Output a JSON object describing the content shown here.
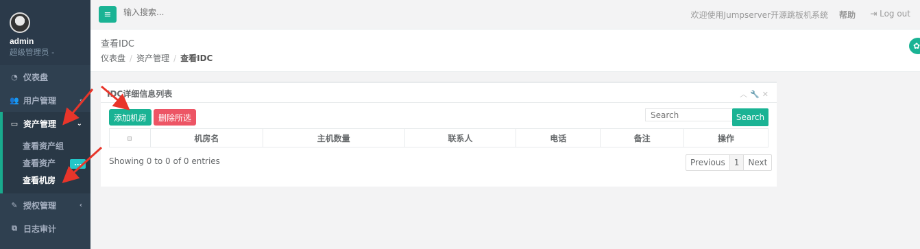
{
  "sidebar": {
    "user_name": "admin",
    "user_role": "超级管理员 -",
    "items": [
      {
        "label": "仪表盘",
        "icon": "dashboard-icon"
      },
      {
        "label": "用户管理",
        "icon": "users-icon"
      },
      {
        "label": "资产管理",
        "icon": "inbox-icon"
      },
      {
        "label": "授权管理",
        "icon": "edit-icon"
      },
      {
        "label": "日志审计",
        "icon": "copy-icon"
      }
    ],
    "subitems": [
      {
        "label": "查看资产组"
      },
      {
        "label": "查看资产",
        "badge": "..."
      },
      {
        "label": "查看机房"
      }
    ]
  },
  "topbar": {
    "search_placeholder": "输入搜索...",
    "welcome": "欢迎使用Jumpserver开源跳板机系统",
    "help": "帮助",
    "logout": "Log out"
  },
  "heading": {
    "title": "查看IDC",
    "breadcrumbs": [
      "仪表盘",
      "资产管理",
      "查看IDC"
    ]
  },
  "panel": {
    "title": "IDC详细信息列表",
    "add_button": "添加机房",
    "delete_button": "删除所选",
    "search_placeholder": "Search",
    "search_button": "Search",
    "columns": [
      "机房名",
      "主机数量",
      "联系人",
      "电话",
      "备注",
      "操作"
    ],
    "info": "Showing 0 to 0 of 0 entries",
    "pagination": {
      "previous": "Previous",
      "page": "1",
      "next": "Next"
    }
  },
  "colors": {
    "accent": "#1ab394",
    "danger": "#ed5565",
    "sidebar_bg": "#2f4050",
    "annotation_arrow": "#e8352a"
  }
}
